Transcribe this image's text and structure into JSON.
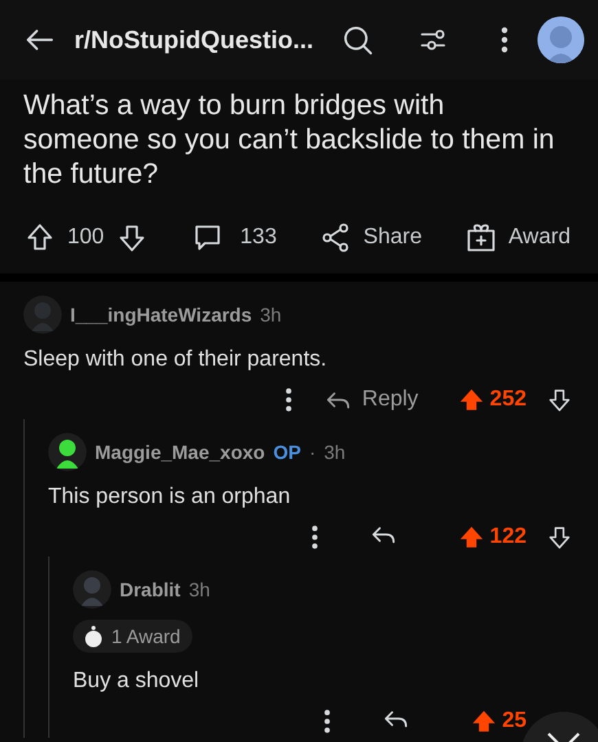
{
  "header": {
    "subreddit": "r/NoStupidQuestio..."
  },
  "post": {
    "title": "What’s a way to burn bridges with someone so you can’t backslide to them in the future?",
    "score": "100",
    "comments": "133",
    "share_label": "Share",
    "award_label": "Award"
  },
  "comments": [
    {
      "author": "I___ingHateWizards",
      "op": false,
      "time": "3h",
      "body": "Sleep with one of their parents.",
      "reply_label": "Reply",
      "score": "252",
      "upvoted": true,
      "children": [
        {
          "author": "Maggie_Mae_xoxo",
          "op": true,
          "op_label": "OP",
          "separator": "·",
          "time": "3h",
          "body": "This person is an orphan",
          "score": "122",
          "upvoted": true,
          "children": [
            {
              "author": "Drablit",
              "op": false,
              "time": "3h",
              "awards": "1 Award",
              "body": "Buy a shovel",
              "score": "25",
              "upvoted": true,
              "downvote_visible": false
            }
          ]
        }
      ]
    }
  ]
}
